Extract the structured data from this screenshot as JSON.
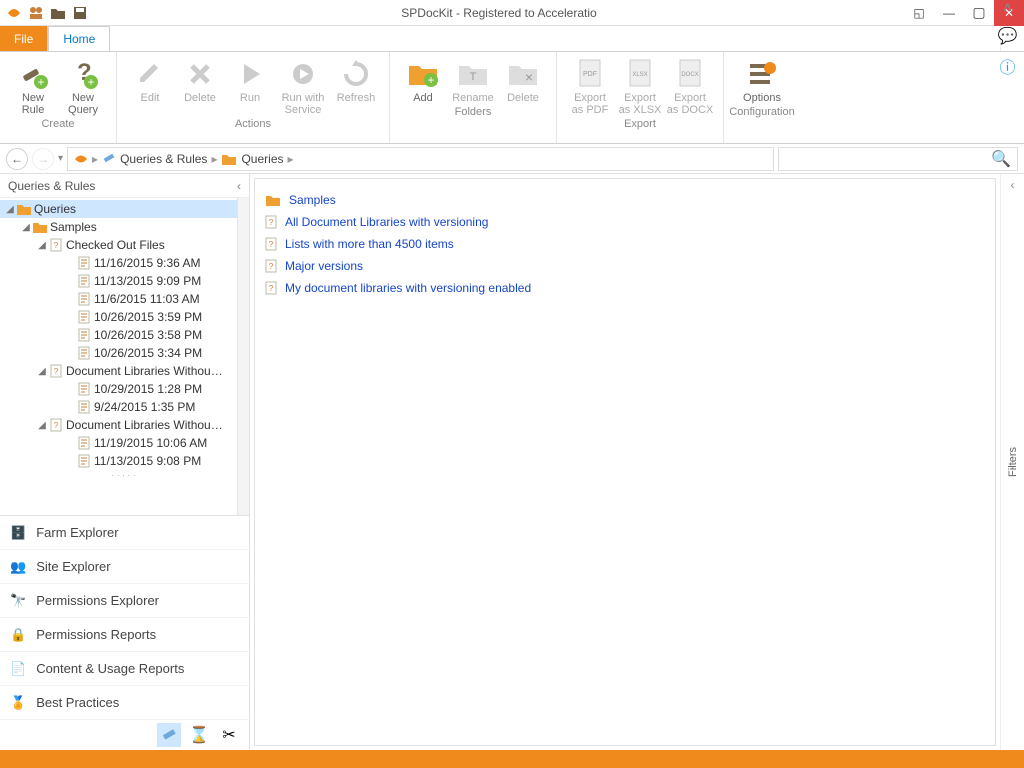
{
  "title": "SPDocKit - Registered to Acceleratio",
  "tabs": {
    "file": "File",
    "home": "Home"
  },
  "ribbon": {
    "create": {
      "label": "Create",
      "new_rule": "New Rule",
      "new_query": "New Query"
    },
    "actions": {
      "label": "Actions",
      "edit": "Edit",
      "delete": "Delete",
      "run": "Run",
      "run_service": "Run with\nService",
      "refresh": "Refresh"
    },
    "folders": {
      "label": "Folders",
      "add": "Add",
      "rename": "Rename",
      "delete": "Delete"
    },
    "export": {
      "label": "Export",
      "pdf": "Export\nas PDF",
      "xlsx": "Export\nas XLSX",
      "docx": "Export\nas DOCX"
    },
    "config": {
      "label": "Configuration",
      "options": "Options"
    }
  },
  "breadcrumb": [
    "Queries & Rules",
    "Queries"
  ],
  "left_pane_title": "Queries & Rules",
  "tree": {
    "root": "Queries",
    "samples": "Samples",
    "checked_out": "Checked Out Files",
    "dates_a": [
      "11/16/2015 9:36 AM",
      "11/13/2015 9:09 PM",
      "11/6/2015 11:03 AM",
      "10/26/2015 3:59 PM",
      "10/26/2015 3:58 PM",
      "10/26/2015 3:34 PM"
    ],
    "dlw1": "Document Libraries Withou…",
    "dates_b": [
      "10/29/2015 1:28 PM",
      "9/24/2015 1:35 PM"
    ],
    "dlw2": "Document Libraries Withou…",
    "dates_c": [
      "11/19/2015 10:06 AM",
      "11/13/2015 9:08 PM"
    ]
  },
  "nav": [
    "Farm Explorer",
    "Site Explorer",
    "Permissions Explorer",
    "Permissions Reports",
    "Content & Usage Reports",
    "Best Practices"
  ],
  "main_items": {
    "folder": "Samples",
    "links": [
      "All Document Libraries with versioning",
      "Lists with more than 4500 items",
      "Major versions",
      "My document libraries with versioning enabled"
    ]
  },
  "filters_label": "Filters"
}
